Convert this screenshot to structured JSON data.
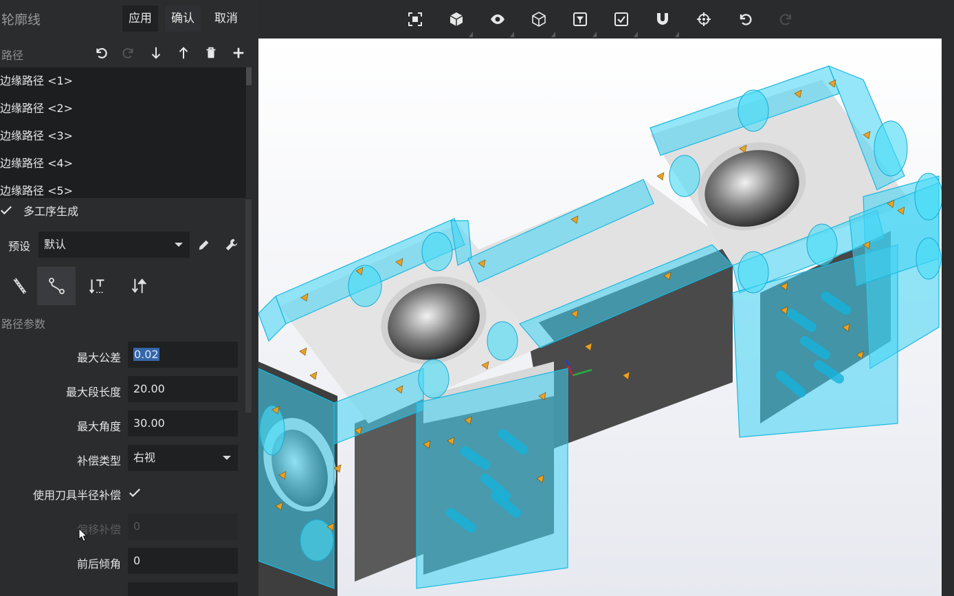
{
  "panel": {
    "title": "轮廓线",
    "apply": "应用",
    "confirm": "确认",
    "cancel": "取消",
    "path_section": "路径",
    "paths": [
      "边缘路径 <1>",
      "边缘路径 <2>",
      "边缘路径 <3>",
      "边缘路径 <4>",
      "边缘路径 <5>"
    ],
    "multi_op": "多工序生成",
    "preset_label": "预设",
    "preset_value": "默认",
    "param_section": "路径参数",
    "max_tolerance_label": "最大公差",
    "max_tolerance_value": "0.02",
    "max_segment_label": "最大段长度",
    "max_segment_value": "20.00",
    "max_angle_label": "最大角度",
    "max_angle_value": "30.00",
    "comp_type_label": "补偿类型",
    "comp_type_value": "右视",
    "tool_radius_label": "使用刀具半径补偿",
    "offset_label": "偏移补偿",
    "offset_value": "0",
    "tilt_label": "前后倾角",
    "tilt_value": "0"
  },
  "colors": {
    "accent_cyan": "#4fd6f2",
    "selection": "#3667a8",
    "panel_bg": "#2b2c2e"
  }
}
